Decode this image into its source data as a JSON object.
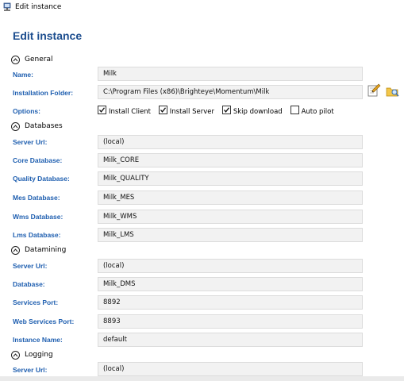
{
  "window": {
    "title": "Edit instance"
  },
  "page": {
    "heading": "Edit instance"
  },
  "sections": {
    "general": "General",
    "databases": "Databases",
    "datamining": "Datamining",
    "logging": "Logging"
  },
  "general": {
    "name_label": "Name:",
    "name_value": "Milk",
    "folder_label": "Installation Folder:",
    "folder_value": "C:\\Program Files (x86)\\Brighteye\\Momentum\\Milk",
    "options_label": "Options:",
    "options": [
      {
        "label": "Install Client",
        "checked": true
      },
      {
        "label": "Install Server",
        "checked": true
      },
      {
        "label": "Skip download",
        "checked": true
      },
      {
        "label": "Auto pilot",
        "checked": false
      }
    ]
  },
  "databases": {
    "server_url_label": "Server Url:",
    "server_url_value": "(local)",
    "core_label": "Core Database:",
    "core_value": "Milk_CORE",
    "quality_label": "Quality Database:",
    "quality_value": "Milk_QUALITY",
    "mes_label": "Mes Database:",
    "mes_value": "Milk_MES",
    "wms_label": "Wms Database:",
    "wms_value": "Milk_WMS",
    "lms_label": "Lms Database:",
    "lms_value": "Milk_LMS"
  },
  "datamining": {
    "server_url_label": "Server Url:",
    "server_url_value": "(local)",
    "database_label": "Database:",
    "database_value": "Milk_DMS",
    "services_port_label": "Services Port:",
    "services_port_value": "8892",
    "web_services_port_label": "Web Services Port:",
    "web_services_port_value": "8893",
    "instance_name_label": "Instance Name:",
    "instance_name_value": "default"
  },
  "logging": {
    "server_url_label": "Server Url:",
    "server_url_value": "(local)"
  },
  "icons": {
    "app": "app-window-icon",
    "edit_folder": "edit-pencil-icon",
    "browse_folder": "browse-folder-icon",
    "collapse": "chevron-up-icon"
  },
  "colors": {
    "heading": "#1d4e8f",
    "label": "#1f5fb0",
    "field_bg": "#f2f2f2"
  }
}
